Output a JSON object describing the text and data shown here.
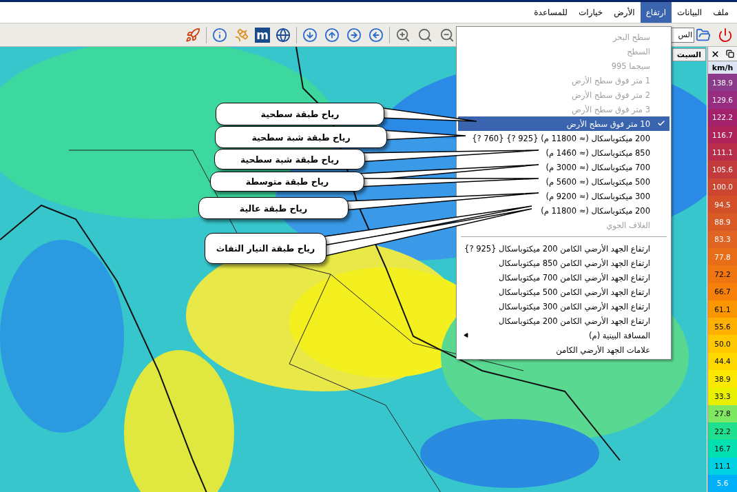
{
  "menu_bar": [
    {
      "label": "ملف",
      "selected": false
    },
    {
      "label": "البيانات",
      "selected": false
    },
    {
      "label": "ارتفاع",
      "selected": true
    },
    {
      "label": "الأرض",
      "selected": false
    },
    {
      "label": "خيارات",
      "selected": false
    },
    {
      "label": "للمساعدة",
      "selected": false
    }
  ],
  "toolbar": {
    "field_value": "الس",
    "logo_letter": "m"
  },
  "side_panel": {
    "title": "السبت"
  },
  "dropdown": [
    {
      "kind": "item",
      "label": "سطح البحر",
      "disabled": true,
      "selected": false
    },
    {
      "kind": "item",
      "label": "السطح",
      "disabled": true,
      "selected": false
    },
    {
      "kind": "item",
      "label": "سيجما 995",
      "disabled": true,
      "selected": false
    },
    {
      "kind": "item",
      "label": "1 متر فوق سطح الأرض",
      "disabled": true,
      "selected": false
    },
    {
      "kind": "item",
      "label": "2 متر فوق سطح الأرض",
      "disabled": true,
      "selected": false
    },
    {
      "kind": "item",
      "label": "3 متر فوق سطح الأرض",
      "disabled": true,
      "selected": false
    },
    {
      "kind": "item",
      "label": "10 متر فوق سطح الأرض",
      "disabled": false,
      "selected": true
    },
    {
      "kind": "item",
      "label": "200 ميكتوباسكال (≈ 11800 م) {925 ?} {760 ?}",
      "disabled": false,
      "selected": false
    },
    {
      "kind": "item",
      "label": "850 ميكتوباسكال (≈ 1460 م)",
      "disabled": false,
      "selected": false
    },
    {
      "kind": "item",
      "label": "700 ميكتوباسكال (≈ 3000 م)",
      "disabled": false,
      "selected": false
    },
    {
      "kind": "item",
      "label": "500 ميكتوباسكال (≈ 5600 م)",
      "disabled": false,
      "selected": false
    },
    {
      "kind": "item",
      "label": "300 ميكتوباسكال (≈ 9200 م)",
      "disabled": false,
      "selected": false
    },
    {
      "kind": "item",
      "label": "200 ميكتوباسكال (≈ 11800 م)",
      "disabled": false,
      "selected": false
    },
    {
      "kind": "item",
      "label": "الغلاف الجوي",
      "disabled": true,
      "selected": false
    },
    {
      "kind": "separator"
    },
    {
      "kind": "item",
      "label": "ارتفاع الجهد الأرضي الكامن 200 ميكتوباسكال {925 ?}",
      "disabled": false,
      "selected": false
    },
    {
      "kind": "item",
      "label": "ارتفاع الجهد الأرضي الكامن 850 ميكتوباسكال",
      "disabled": false,
      "selected": false
    },
    {
      "kind": "item",
      "label": "ارتفاع الجهد الأرضي الكامن 700 ميكتوباسكال",
      "disabled": false,
      "selected": false
    },
    {
      "kind": "item",
      "label": "ارتفاع الجهد الأرضي الكامن 500 ميكتوباسكال",
      "disabled": false,
      "selected": false
    },
    {
      "kind": "item",
      "label": "ارتفاع الجهد الأرضي الكامن 300 ميكتوباسكال",
      "disabled": false,
      "selected": false
    },
    {
      "kind": "item",
      "label": "ارتفاع الجهد الأرضي الكامن 200 ميكتوباسكال",
      "disabled": false,
      "selected": false
    },
    {
      "kind": "submenu",
      "label": "المسافة البينية (م)",
      "disabled": false,
      "selected": false
    },
    {
      "kind": "item",
      "label": "علامات الجهد الأرضي الكامن",
      "disabled": false,
      "selected": false
    }
  ],
  "callouts": [
    "رياح طبقة سطحية",
    "رياح طبقة شبة سطحية",
    "رياح طبقة شبة سطحية",
    "رياح طبقة متوسطة",
    "رياح طبقة عالية",
    "رياح طبقة النيار النفاث"
  ],
  "legend": {
    "unit": "km/h",
    "steps": [
      {
        "value": "138.9",
        "color": "#8c3a8c"
      },
      {
        "value": "129.6",
        "color": "#982c80"
      },
      {
        "value": "122.2",
        "color": "#a4226c"
      },
      {
        "value": "116.7",
        "color": "#ae245a"
      },
      {
        "value": "111.1",
        "color": "#b82e4a"
      },
      {
        "value": "105.6",
        "color": "#c23a3c"
      },
      {
        "value": "100.0",
        "color": "#cc4632"
      },
      {
        "value": "94.5",
        "color": "#d4502a"
      },
      {
        "value": "88.9",
        "color": "#da5a26"
      },
      {
        "value": "83.3",
        "color": "#e06422"
      },
      {
        "value": "77.8",
        "color": "#e86e1a"
      },
      {
        "value": "72.2",
        "color": "#f07612"
      },
      {
        "value": "66.7",
        "color": "#f6800a"
      },
      {
        "value": "61.1",
        "color": "#fa9600"
      },
      {
        "value": "55.6",
        "color": "#ffb000"
      },
      {
        "value": "50.0",
        "color": "#ffc800"
      },
      {
        "value": "44.4",
        "color": "#ffd800"
      },
      {
        "value": "38.9",
        "color": "#fce800"
      },
      {
        "value": "33.3",
        "color": "#e8f000"
      },
      {
        "value": "27.8",
        "color": "#80e860"
      },
      {
        "value": "22.2",
        "color": "#20e090"
      },
      {
        "value": "16.7",
        "color": "#00e0b0"
      },
      {
        "value": "11.1",
        "color": "#00d0e0"
      },
      {
        "value": "5.6",
        "color": "#00b0f8"
      }
    ]
  }
}
